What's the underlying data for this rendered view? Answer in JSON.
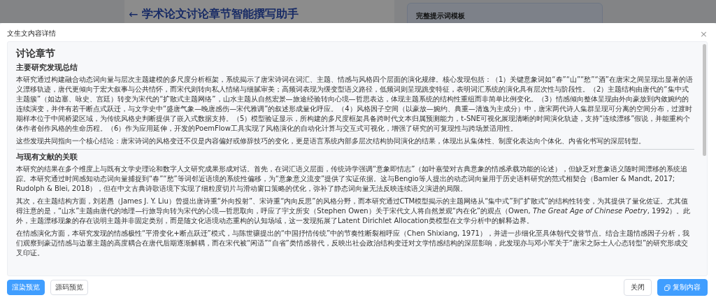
{
  "background": {
    "back_arrow": "←",
    "title": "学术论文讨论章节智能撰写助手",
    "card_title": "完整提示词模板"
  },
  "dialog": {
    "title": "文生文内容详情",
    "close": "×"
  },
  "document": {
    "heading": "讨论章节",
    "sections": [
      {
        "title": "主要研究发现总结",
        "paragraphs": [
          "本研究通过构建融合动态词向量与层次主题建模的多尺度分析框架，系统揭示了唐宋诗词在词汇、主题、情感与风格四个层面的演化规律。核心发现包括：（1）关键意象词如“春”“山”“愁”“酒”在唐宋之间呈现出显著的语义漂移轨迹，唐代更倾向于宏大叙事与公共情怀，而宋代则转向私人情绪与细腻审美；高频词表现为缓变型语义路径，低频词则呈现跳变特征，表明词汇系统的演化具有层次性与阶段性。（2）主题结构由唐代的“集中式主题簇”（如边塞、咏史、宫廷）转变为宋代的“扩散式主题网络”，山水主题从自然宏景—旅途经验转向心境—哲思表达，体现主题系统的结构性重组而非简单比例变化。（3）情感倾向整体呈现由外向豪放到内敛婉约的连续演变，并伴有若干断点式跃迁，与文学史中“盛唐气象—晚唐感伤—宋代雅调”的叙述形成量化呼应。（4）风格因子空间（以豪放—婉约、典重—清逸为主成分）中，唐宋两代诗人集群呈现可分离的空间分布，过渡时期样本位于中间桥梁区域，为传统风格史判断提供了嵌入式数据支持。（5）模型验证显示，所构建的多尺度框架具备跨时代文本归属预测能力，t-SNE可视化展现清晰的时间演化轨迹，支持“连续漂移”假说，并能重构个体作者创作风格的生命历程。（6）作为应用延伸，开发的PoemFlow工具实现了风格演化的自动化计算与交互式可视化，增强了研究的可复现性与跨场景适用性。",
          "这些发现共同指向一个核心结论：唐宋诗词的风格变迁不仅是内容偏好或修辞技巧的变化，更是语言系统内部多层次结构协同演化的结果，体现出从集体性、制度化表达向个体化、内省化书写的深层转型。"
        ]
      },
      {
        "title": "与现有文献的关联",
        "paragraphs": [
          "本研究的结果在多个维度上与既有文学史理论和数字人文研究成果形成对话。首先，在词汇语义层面，传统诗学强调“意象即情志”（如叶嘉莹对古典意象的情感承载功能的论述），但缺乏对意象语义随时间漂移的系统追踪。本研究通过时间感知动态词向量捕捉到“春”“愁”等词邻近语境的系统性偏移，为“意象意义流变”提供了实证依据。这与Bengio等人提出的动态词向量用于历史语料研究的范式相契合（Bamler & Mandt, 2017; Rudolph & Blei, 2018），但在中文古典诗歌语境下实现了细粒度切片与滑动窗口策略的优化，弥补了静态词向量无法反映连续语义演进的局限。",
          "其次，在主题结构方面，刘若愚（James J. Y. Liu）曾提出唐诗重“外向投射”、宋诗重“内向反思”的风格分野，而本研究通过CTM模型揭示的主题网络从“集中式”到“扩散式”的结构性转变，为其提供了量化佐证。尤其值得注意的是，“山水”主题由唐代的地理—行旅导向转为宋代的心境—哲思取向，呼应了宇文所安（Stephen Owen）关于宋代文人将自然景观“内在化”的观点（Owen, *The Great Age of Chinese Poetry*, 1992）。此外，主题漂移现象的存在说明主题并非固定类别，而是随文化语境动态重构的认知场域，这一发现拓展了Latent Dirichlet Allocation类模型在文学分析中的解释边界。",
          "在情感演化方面，本研究发现的情感极性“平滑变化+断点跃迁”模式，与陈世骧提出的“中国抒情传统”中的节奏性断裂相呼应（Chen Shixiang, 1971），并进一步细化至具体朝代交替节点。结合主题情感因子分析，我们观察到豪迈情感与边塞主题的高度耦合在唐代后期逐渐解耦，而在宋代被“闲适”“自省”类情感替代，反映出社会政治结构变迁对文学情感结构的深层影响，此发现亦与邓小军关于“唐宋之际士人心态转型”的研究形成交叉印证。"
        ]
      }
    ]
  },
  "view_tabs": [
    {
      "label": "渲染预览",
      "selected": true
    },
    {
      "label": "源码预览",
      "selected": false
    }
  ],
  "buttons": [
    {
      "label": "关闭",
      "kind": "default"
    },
    {
      "label": "复制内容",
      "kind": "primary"
    }
  ]
}
